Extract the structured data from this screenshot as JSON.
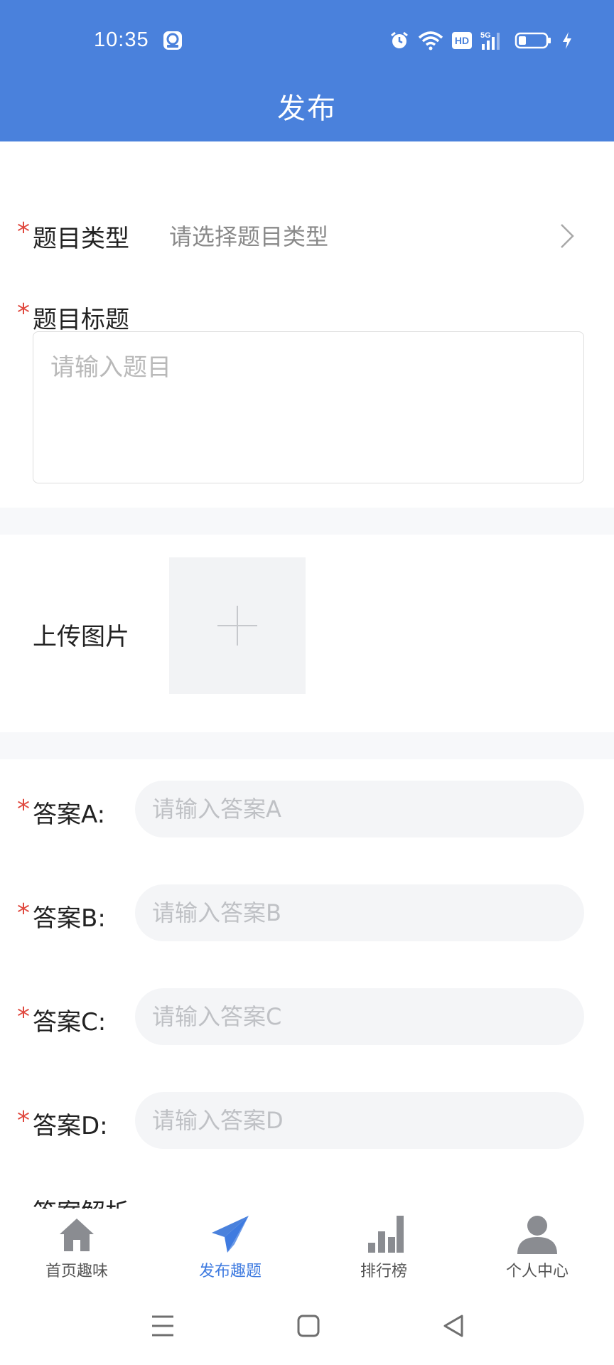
{
  "status_bar": {
    "time": "10:35",
    "hd_badge": "HD",
    "network": "5G"
  },
  "header": {
    "title": "发布"
  },
  "form": {
    "question_type": {
      "required_mark": "*",
      "label": "题目类型",
      "placeholder": "请选择题目类型"
    },
    "question_title": {
      "required_mark": "*",
      "label": "题目标题",
      "placeholder": "请输入题目"
    },
    "upload": {
      "label": "上传图片"
    },
    "answers": [
      {
        "required_mark": "*",
        "label": "答案A:",
        "placeholder": "请输入答案A"
      },
      {
        "required_mark": "*",
        "label": "答案B:",
        "placeholder": "请输入答案B"
      },
      {
        "required_mark": "*",
        "label": "答案C:",
        "placeholder": "请输入答案C"
      },
      {
        "required_mark": "*",
        "label": "答案D:",
        "placeholder": "请输入答案D"
      }
    ],
    "next_field_label": "答案解析"
  },
  "tabbar": {
    "items": [
      {
        "label": "首页趣味",
        "icon": "home-icon",
        "active": false
      },
      {
        "label": "发布趣题",
        "icon": "paper-plane-icon",
        "active": true
      },
      {
        "label": "排行榜",
        "icon": "bar-chart-icon",
        "active": false
      },
      {
        "label": "个人中心",
        "icon": "person-icon",
        "active": false
      }
    ]
  },
  "colors": {
    "header": "#4a81dc",
    "required": "#e0493f",
    "active_tab": "#3f7be0",
    "inactive_icon": "#8a8c91"
  }
}
